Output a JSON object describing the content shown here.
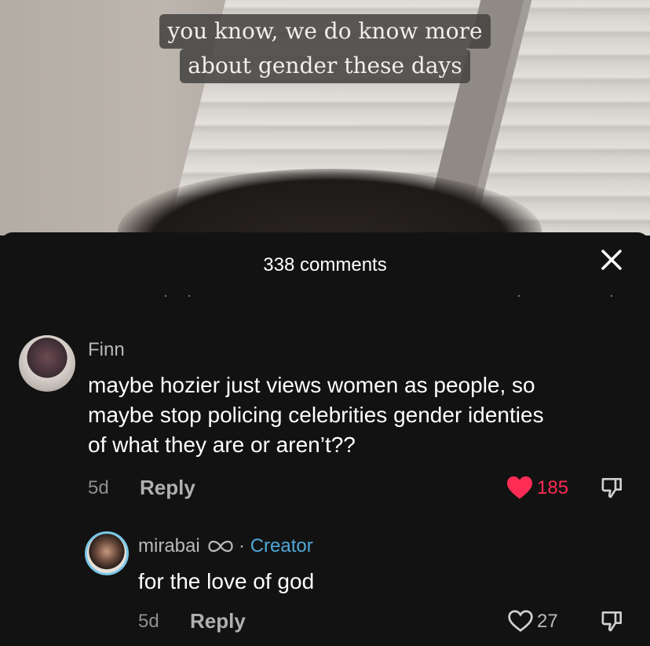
{
  "video": {
    "caption_line1": "you know, we do know more",
    "caption_line2": "about gender these days"
  },
  "comments_header": {
    "title": "338 comments",
    "close_icon": "close-icon"
  },
  "comments": [
    {
      "author": "Finn",
      "text_lines": [
        "maybe hozier just views women as people, so",
        "maybe stop policing celebrities gender identies",
        "of what they are or aren’t??"
      ],
      "age": "5d",
      "reply_label": "Reply",
      "likes": "185",
      "liked": true
    }
  ],
  "reply": {
    "author": "mirabai",
    "badge_icon": "infinity-icon",
    "separator": "·",
    "role": "Creator",
    "text": "for the love of god",
    "age": "5d",
    "reply_label": "Reply",
    "likes": "27",
    "liked": false
  },
  "colors": {
    "like_active": "#fe2c55",
    "creator": "#4fa8d8",
    "background": "#121212"
  }
}
